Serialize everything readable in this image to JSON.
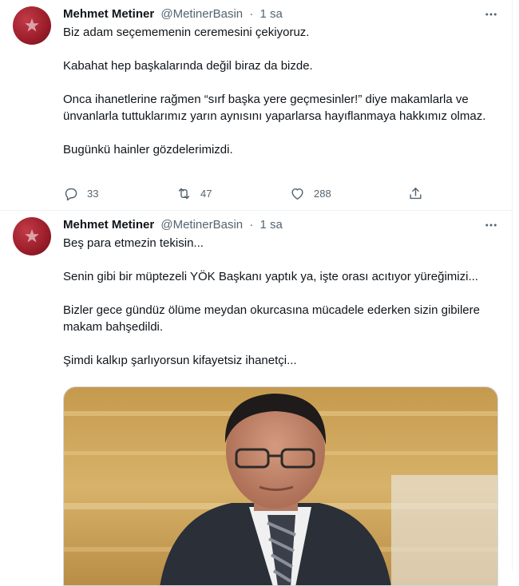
{
  "tweets": [
    {
      "author_name": "Mehmet Metiner",
      "author_handle": "@MetinerBasin",
      "separator": "·",
      "time": "1 sa",
      "text": "Biz adam seçememenin ceremesini çekiyoruz.\n\nKabahat hep başkalarında değil biraz da bizde.\n\nOnca ihanetlerine rağmen “sırf başka yere geçmesinler!” diye makamlarla ve ünvanlarla tuttuklarımız yarın aynısını yaparlarsa hayıflanmaya hakkımız olmaz.\n\nBugünkü hainler gözdelerimizdi.",
      "replies": "33",
      "retweets": "47",
      "likes": "288"
    },
    {
      "author_name": "Mehmet Metiner",
      "author_handle": "@MetinerBasin",
      "separator": "·",
      "time": "1 sa",
      "text": "Beş para etmezin tekisin...\n\nSenin gibi bir müptezeli YÖK Başkanı yaptık ya, işte orası acıtıyor yüreğimizi...\n\nBizler gece gündüz ölüme meydan okurcasına mücadele ederken sizin gibilere makam bahşedildi.\n\nŞimdi kalkıp şarlıyorsun kifayetsiz ihanetçi..."
    }
  ],
  "icons": {
    "avatar": "crescent-star-flag",
    "more": "more-horizontal-icon",
    "reply": "reply-icon",
    "retweet": "retweet-icon",
    "like": "heart-icon",
    "share": "share-icon"
  },
  "colors": {
    "text": "#0f1419",
    "secondary": "#536471",
    "border": "#eff3f4",
    "avatar": "#9e1f2c"
  }
}
